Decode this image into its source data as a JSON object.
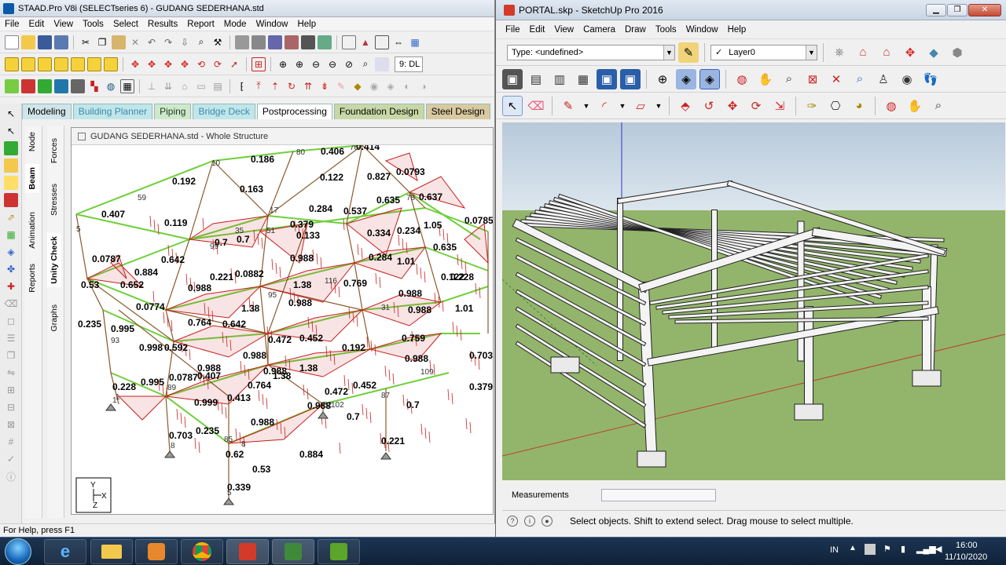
{
  "staad": {
    "title": "STAAD.Pro V8i (SELECTseries 6) - GUDANG SEDERHANA.std",
    "menu": [
      "File",
      "Edit",
      "View",
      "Tools",
      "Select",
      "Results",
      "Report",
      "Mode",
      "Window",
      "Help"
    ],
    "load_combo": "9: DL",
    "tabs": [
      "Modeling",
      "Building Planner",
      "Piping",
      "Bridge Deck",
      "Postprocessing",
      "Foundation Design",
      "Steel Design"
    ],
    "vtabs_left": [
      "Node",
      "Beam",
      "Animation",
      "Reports"
    ],
    "vtabs_right": [
      "Forces",
      "Stresses",
      "Unity Check",
      "Graphs"
    ],
    "doc_title": "GUDANG SEDERHANA.std - Whole Structure",
    "status": "For Help, press F1",
    "axes": {
      "y": "Y",
      "x": "X",
      "z": "Z"
    },
    "labels": [
      {
        "t": "0.406"
      },
      {
        "t": "0.414"
      },
      {
        "t": "0.186"
      },
      {
        "t": "0.192"
      },
      {
        "t": "0.122"
      },
      {
        "t": "0.827"
      },
      {
        "t": "0.0793"
      },
      {
        "t": "0.163"
      },
      {
        "t": "0.635"
      },
      {
        "t": "0.637"
      },
      {
        "t": "0.407"
      },
      {
        "t": "0.284"
      },
      {
        "t": "0.537"
      },
      {
        "t": "0.119"
      },
      {
        "t": "0.379"
      },
      {
        "t": "0.0785"
      },
      {
        "t": "1.05"
      },
      {
        "t": "0.334"
      },
      {
        "t": "0.133"
      },
      {
        "t": "0.234"
      },
      {
        "t": "0.7"
      },
      {
        "t": "0.7"
      },
      {
        "t": "0.635"
      },
      {
        "t": "0.0787"
      },
      {
        "t": "0.988"
      },
      {
        "t": "0.284"
      },
      {
        "t": "1.01"
      },
      {
        "t": "0.642"
      },
      {
        "t": "0.884"
      },
      {
        "t": "0.221"
      },
      {
        "t": "0.0882"
      },
      {
        "t": "0.652"
      },
      {
        "t": "0.122"
      },
      {
        "t": "0.228"
      },
      {
        "t": "0.53"
      },
      {
        "t": "0.988"
      },
      {
        "t": "1.38"
      },
      {
        "t": "0.769"
      },
      {
        "t": "0.988"
      },
      {
        "t": "0.988"
      },
      {
        "t": "0.0774"
      },
      {
        "t": "1.38"
      },
      {
        "t": "0.988"
      },
      {
        "t": "1.01"
      },
      {
        "t": "0.235"
      },
      {
        "t": "0.995"
      },
      {
        "t": "0.764"
      },
      {
        "t": "0.642"
      },
      {
        "t": "0.472"
      },
      {
        "t": "0.452"
      },
      {
        "t": "0.192"
      },
      {
        "t": "0.759"
      },
      {
        "t": "0.998"
      },
      {
        "t": "0.592"
      },
      {
        "t": "0.988"
      },
      {
        "t": "1.38"
      },
      {
        "t": "0.988"
      },
      {
        "t": "0.988"
      },
      {
        "t": "0.703"
      },
      {
        "t": "0.228"
      },
      {
        "t": "0.995"
      },
      {
        "t": "0.0787"
      },
      {
        "t": "0.407"
      },
      {
        "t": "1.38"
      },
      {
        "t": "0.988"
      },
      {
        "t": "0.379"
      },
      {
        "t": "0.999"
      },
      {
        "t": "0.764"
      },
      {
        "t": "0.413"
      },
      {
        "t": "0.472"
      },
      {
        "t": "0.452"
      },
      {
        "t": "0.7"
      },
      {
        "t": "0.988"
      },
      {
        "t": "0.988"
      },
      {
        "t": "0.7"
      },
      {
        "t": "0.703"
      },
      {
        "t": "0.235"
      },
      {
        "t": "0.62"
      },
      {
        "t": "0.884"
      },
      {
        "t": "0.221"
      },
      {
        "t": "0.53"
      },
      {
        "t": "0.339"
      }
    ],
    "nodes": [
      {
        "t": "80"
      },
      {
        "t": "76"
      },
      {
        "t": "10"
      },
      {
        "t": "59"
      },
      {
        "t": "78"
      },
      {
        "t": "17"
      },
      {
        "t": "5"
      },
      {
        "t": "35"
      },
      {
        "t": "51"
      },
      {
        "t": "99"
      },
      {
        "t": "95"
      },
      {
        "t": "116"
      },
      {
        "t": "31"
      },
      {
        "t": "93"
      },
      {
        "t": "89"
      },
      {
        "t": "1"
      },
      {
        "t": "8"
      },
      {
        "t": "52"
      },
      {
        "t": "102"
      },
      {
        "t": "87"
      },
      {
        "t": "109"
      },
      {
        "t": "85"
      },
      {
        "t": "8"
      },
      {
        "t": "5"
      },
      {
        "t": "1"
      }
    ]
  },
  "sketchup": {
    "title": "PORTAL.skp - SketchUp Pro 2016",
    "menu": [
      "File",
      "Edit",
      "View",
      "Camera",
      "Draw",
      "Tools",
      "Window",
      "Help"
    ],
    "type_combo": "Type: <undefined>",
    "layer_combo": "Layer0",
    "measurements_label": "Measurements",
    "measurements_value": "",
    "status_text": "Select objects. Shift to extend select. Drag mouse to select multiple."
  },
  "taskbar": {
    "lang": "IN",
    "time": "16:00",
    "date": "11/10/2020"
  },
  "colors": {
    "sky": "#c8d6e4",
    "ground": "#93b56b",
    "beam_green": "#6fcf3b",
    "beam_brown": "#8b5a2b",
    "moment_red": "#c81e1e"
  }
}
